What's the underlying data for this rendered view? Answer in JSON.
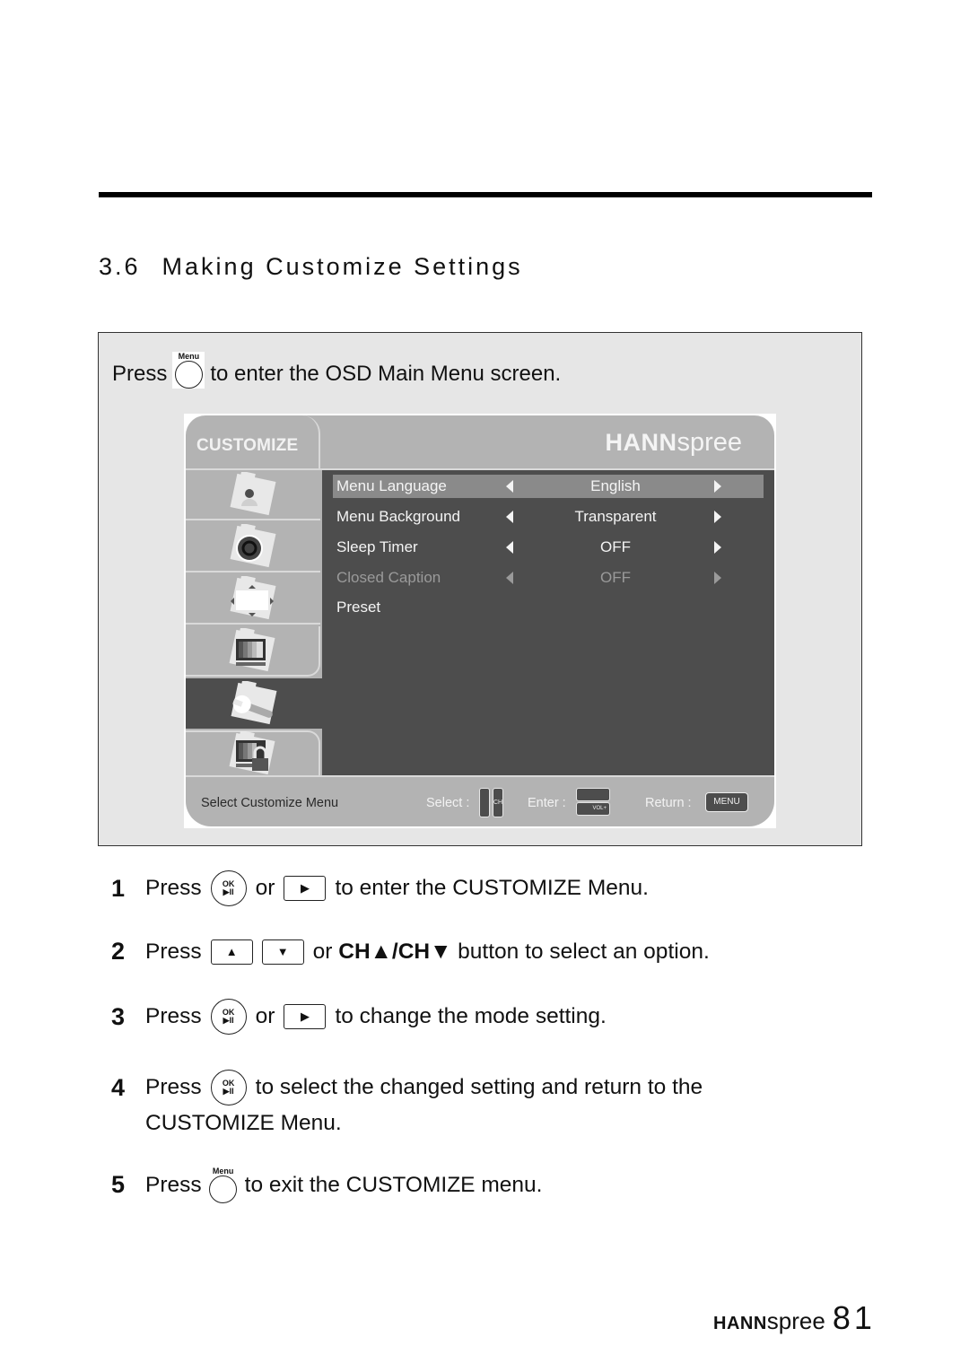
{
  "section": {
    "number": "3.6",
    "title": "Making Customize Settings"
  },
  "intro": {
    "press": "Press",
    "key_label": "Menu",
    "text": "to enter the OSD Main Menu screen."
  },
  "osd": {
    "tab_title": "CUSTOMIZE",
    "brand_bold": "HANN",
    "brand_light": "spree",
    "sidebar": [
      {
        "icon": "picture-icon"
      },
      {
        "icon": "sound-icon"
      },
      {
        "icon": "position-icon"
      },
      {
        "icon": "screen-icon"
      },
      {
        "icon": "customize-wrench-icon",
        "active": true
      },
      {
        "icon": "lock-icon"
      }
    ],
    "options": [
      {
        "name": "Menu Language",
        "value": "English",
        "selected": true
      },
      {
        "name": "Menu Background",
        "value": "Transparent"
      },
      {
        "name": "Sleep Timer",
        "value": "OFF"
      },
      {
        "name": "Closed Caption",
        "value": "OFF",
        "disabled": true
      },
      {
        "name": "Preset",
        "value": ""
      }
    ],
    "footer": {
      "hint": "Select Customize Menu",
      "select_label": "Select :",
      "ch_label": "CH",
      "enter_label": "Enter :",
      "vol_label": "VOL+",
      "return_label": "Return :",
      "menu_key": "MENU"
    }
  },
  "steps": [
    {
      "num": "1",
      "press": "Press",
      "or": "or",
      "text": "to enter the CUSTOMIZE Menu."
    },
    {
      "num": "2",
      "press": "Press",
      "or": "or",
      "ch_up": "CH▲",
      "slash": "/",
      "ch_down": "CH▼",
      "text": "button to select an option."
    },
    {
      "num": "3",
      "press": "Press",
      "or": "or",
      "text": "to change the mode setting."
    },
    {
      "num": "4",
      "press": "Press",
      "text": "to select the changed setting and return to the",
      "continuation": "CUSTOMIZE Menu."
    },
    {
      "num": "5",
      "press": "Press",
      "key_label": "Menu",
      "text": "to exit the CUSTOMIZE menu."
    }
  ],
  "keys": {
    "ok_top": "OK",
    "ok_bottom": "▶II",
    "right": "▶",
    "up": "▲",
    "down": "▼"
  },
  "footer": {
    "brand_bold": "HANN",
    "brand_light": "spree",
    "page": "81"
  }
}
